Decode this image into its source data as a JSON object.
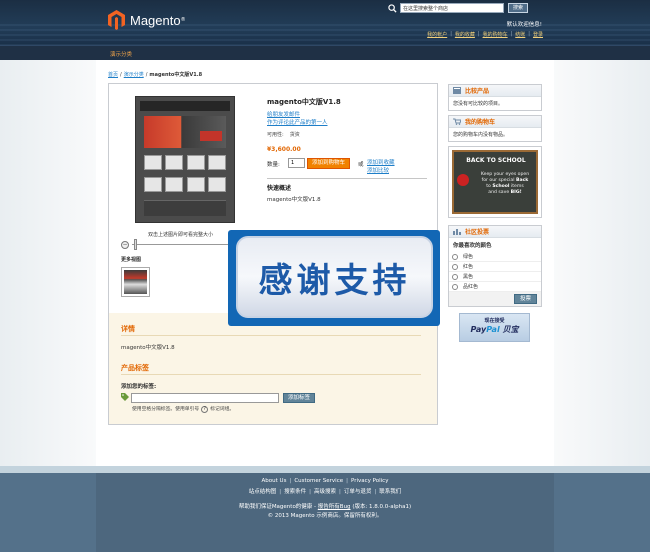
{
  "header": {
    "logo_text": "Magento",
    "logo_reg": "®",
    "search_placeholder": "在这里搜索整个商店",
    "search_button": "搜索",
    "welcome": "默认欢迎信息!",
    "quick_links": [
      "我的帐户",
      "我的收藏",
      "我的购物车",
      "结账",
      "登录"
    ]
  },
  "nav": {
    "items": [
      "演示分类"
    ]
  },
  "breadcrumb": {
    "items": [
      "首页",
      "演示分类"
    ],
    "current": "magento中文版V1.8"
  },
  "product": {
    "title": "magento中文版V1.8",
    "email_friend": "给朋友发邮件",
    "first_review": "作为评论此产品的第一人",
    "availability_label": "可用性:",
    "availability_value": "货资",
    "price": "¥3,600.00",
    "qty_label": "数量:",
    "qty_value": "1",
    "add_to_cart": "添加到购物车",
    "or": "或",
    "add_wishlist": "添加到收藏",
    "add_compare": "添加比较",
    "short_desc_heading": "快速概述",
    "short_desc": "magento中文版V1.8",
    "zoom_hint": "双击上述图片即可看完整大小",
    "more_views": "更多视图",
    "details_heading": "详情",
    "details_text": "magento中文版V1.8",
    "tags_heading": "产品标签",
    "tag_label": "添加您的标签:",
    "tag_button": "添加标签",
    "tag_hint_a": "使用空格分隔标签。使用单引号",
    "tag_hint_b": "标记词组。"
  },
  "sidebar": {
    "compare_title": "比较产品",
    "compare_text": "您没有可比较的项目。",
    "cart_title": "我的购物车",
    "cart_text": "您的购物车内没有物品。",
    "ad": {
      "title": "BACK TO SCHOOL",
      "line1": "Keep your eyes open",
      "line2": "for our special",
      "bold1": "Back",
      "line3": "to",
      "bold2": "School",
      "line4": "items",
      "line5": "and save",
      "bold3": "BIG!"
    },
    "poll_title": "社区投票",
    "poll_question": "你最喜欢的颜色",
    "poll_options": [
      "绿色",
      "红色",
      "黑色",
      "品红色"
    ],
    "poll_button": "投票"
  },
  "paypal": {
    "top": "现在接受",
    "logo_a": "Pay",
    "logo_b": "Pal",
    "logo_c": " 贝宝"
  },
  "overlay": {
    "text": "感谢支持"
  },
  "footer": {
    "row1": [
      "About Us",
      "Customer Service",
      "Privacy Policy"
    ],
    "row2": [
      "站点结构图",
      "搜索条件",
      "高级搜索",
      "订单与退货",
      "联系我们"
    ],
    "row3_a": "帮助我们保证Magento的健康 -",
    "row3_link": "报告所有Bug",
    "row3_b": "(版本: 1.8.0.0-alpha1)",
    "copyright": "© 2013 Magento 示例商店。保留所有权利。"
  },
  "colors": {
    "accent_orange": "#e26703",
    "link_blue": "#1e7ec8",
    "header_navy": "#1b2e43"
  }
}
